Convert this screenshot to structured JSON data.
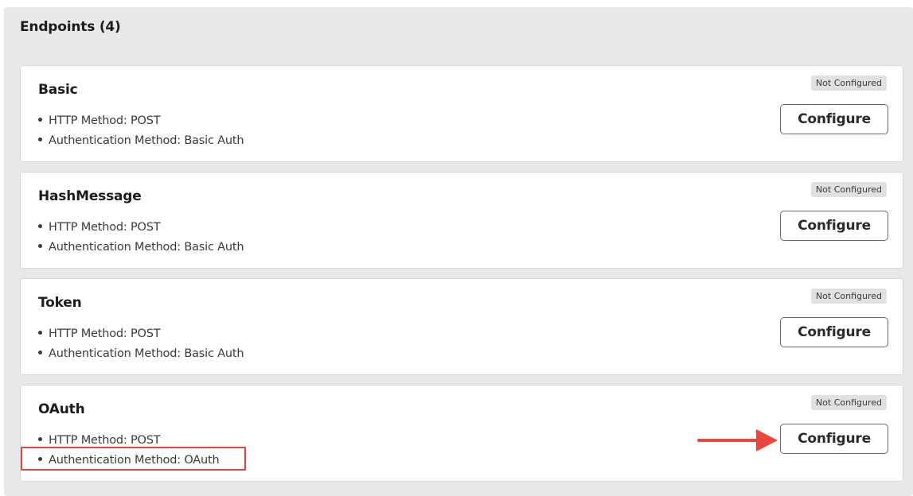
{
  "panel": {
    "title": "Endpoints (4)"
  },
  "endpoints": [
    {
      "name": "Basic",
      "status": "Not Configured",
      "details": [
        "HTTP Method: POST",
        "Authentication Method: Basic Auth"
      ],
      "button_label": "Configure"
    },
    {
      "name": "HashMessage",
      "status": "Not Configured",
      "details": [
        "HTTP Method: POST",
        "Authentication Method: Basic Auth"
      ],
      "button_label": "Configure"
    },
    {
      "name": "Token",
      "status": "Not Configured",
      "details": [
        "HTTP Method: POST",
        "Authentication Method: Basic Auth"
      ],
      "button_label": "Configure"
    },
    {
      "name": "OAuth",
      "status": "Not Configured",
      "details": [
        "HTTP Method: POST",
        "Authentication Method: OAuth"
      ],
      "button_label": "Configure"
    }
  ],
  "annotations": {
    "highlight_color": "#e0463b",
    "arrow_color": "#e8483c"
  }
}
